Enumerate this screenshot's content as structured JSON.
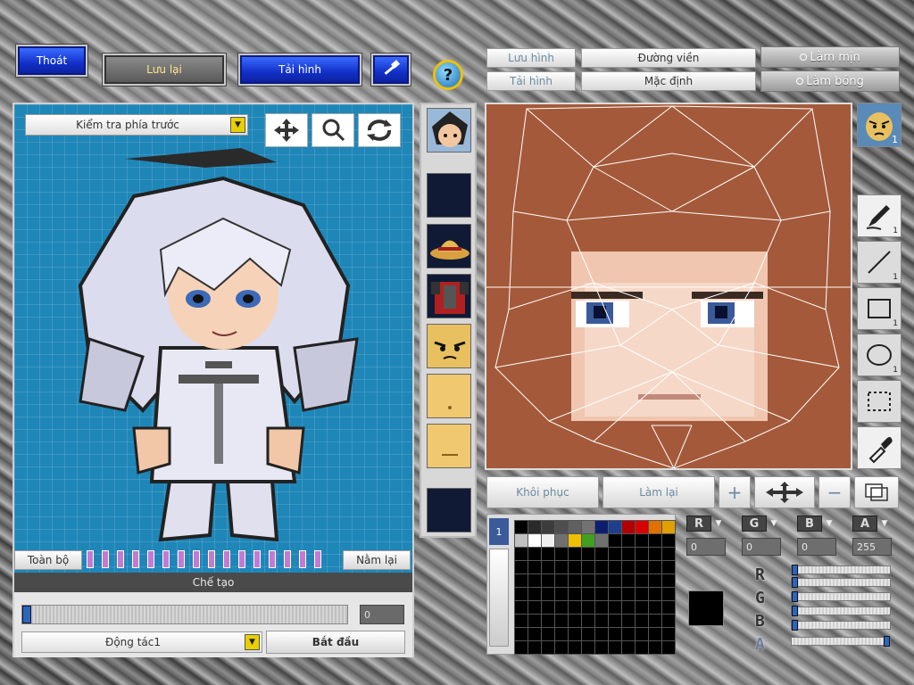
{
  "top_bar": {
    "exit_label": "Thoát",
    "save_label": "Lưu lại",
    "reload_label": "Tải hình",
    "help_glyph": "?"
  },
  "left_panel": {
    "view_dropdown": "Kiểm tra phía trước",
    "all_label": "Toàn bộ",
    "reset_label": "Nằm lại",
    "create_title": "Chế tạo",
    "frame_value": "0",
    "action_dropdown": "Động tác1",
    "start_label": "Bắt đầu",
    "tick_count": 16
  },
  "right_top": {
    "save_label": "Lưu hình",
    "load_label": "Tải hình",
    "outline_label": "Đường viền",
    "default_label": "Mặc định",
    "smooth_label": "Làm mịn",
    "shine_label": "Làm bóng"
  },
  "tools": [
    {
      "name": "face-layer",
      "count": "1"
    },
    {
      "name": "pen",
      "count": "1"
    },
    {
      "name": "line",
      "count": "1"
    },
    {
      "name": "rectangle",
      "count": "1"
    },
    {
      "name": "ellipse",
      "count": "1"
    },
    {
      "name": "selection",
      "count": ""
    },
    {
      "name": "eyedropper",
      "count": ""
    }
  ],
  "actions": {
    "restore_label": "Khôi phục",
    "redo_label": "Làm lại",
    "zoom_in_glyph": "+",
    "zoom_out_glyph": "−"
  },
  "palette": {
    "tab_label": "1",
    "colors": [
      "#000000",
      "#2a2a2a",
      "#3c3c3c",
      "#4e4e4e",
      "#606060",
      "#727272",
      "#0e1e6e",
      "#1e3e8e",
      "#b00000",
      "#d80000",
      "#e07000",
      "#e0a000",
      "#c0c0c0",
      "#ffffff",
      "#f0f0f0",
      "#707070",
      "#f0c000",
      "#40a020",
      "#707070"
    ]
  },
  "color_channels": {
    "labels": [
      "R",
      "G",
      "B",
      "A"
    ],
    "values": [
      "0",
      "0",
      "0",
      "255"
    ],
    "slider_fractions": [
      0.0,
      0.0,
      0.0,
      1.0
    ]
  }
}
